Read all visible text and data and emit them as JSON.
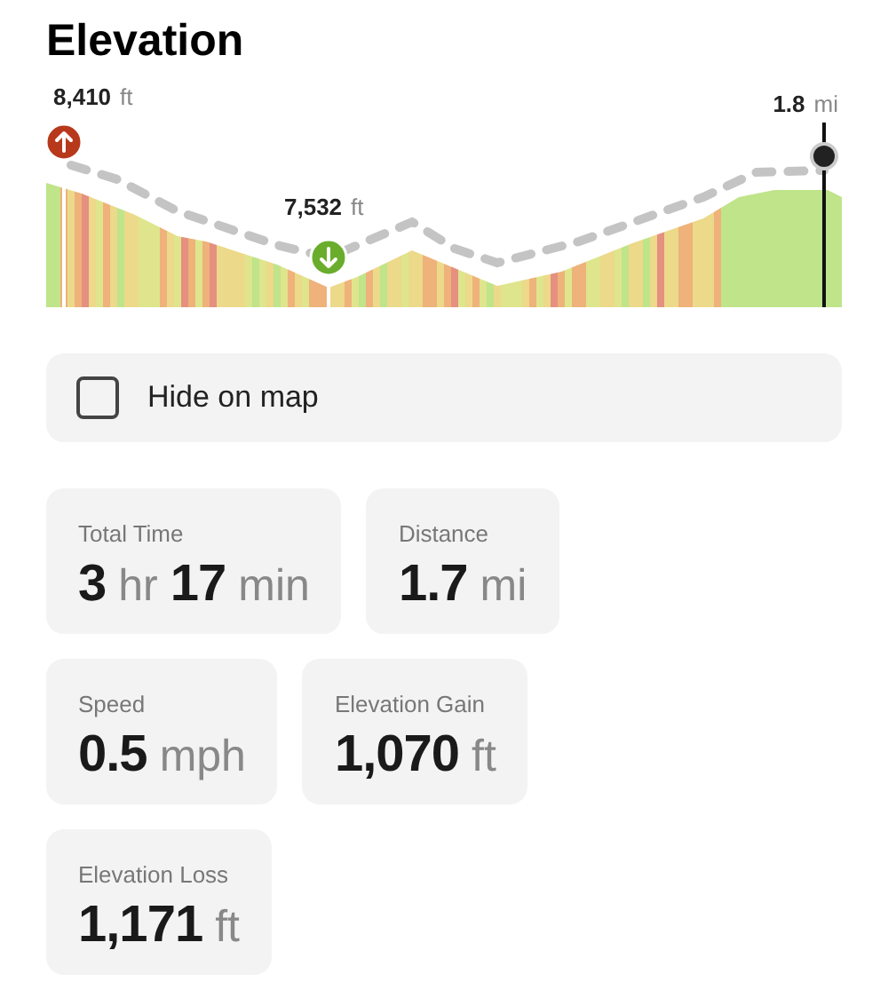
{
  "title": "Elevation",
  "profile": {
    "labels": [
      {
        "kind": "high",
        "value": "8,410",
        "unit": "ft"
      },
      {
        "kind": "low",
        "value": "7,532",
        "unit": "ft"
      },
      {
        "kind": "cursor",
        "value": "1.8",
        "unit": "mi"
      }
    ]
  },
  "hide_on_map": {
    "label": "Hide on map",
    "checked": false
  },
  "stats": [
    {
      "label": "Total Time",
      "value": [
        {
          "kind": "number",
          "text": "3"
        },
        {
          "kind": "unit",
          "text": "hr"
        },
        {
          "kind": "number",
          "text": "17"
        },
        {
          "kind": "unit",
          "text": "min"
        }
      ]
    },
    {
      "label": "Distance",
      "value": [
        {
          "kind": "number",
          "text": "1.7"
        },
        {
          "kind": "unit",
          "text": "mi"
        }
      ]
    },
    {
      "label": "Speed",
      "value": [
        {
          "kind": "number",
          "text": "0.5"
        },
        {
          "kind": "unit",
          "text": "mph"
        }
      ]
    },
    {
      "label": "Elevation Gain",
      "value": [
        {
          "kind": "number",
          "text": "1,070"
        },
        {
          "kind": "unit",
          "text": "ft"
        }
      ]
    },
    {
      "label": "Elevation Loss",
      "value": [
        {
          "kind": "number",
          "text": "1,171"
        },
        {
          "kind": "unit",
          "text": "ft"
        }
      ]
    }
  ]
}
